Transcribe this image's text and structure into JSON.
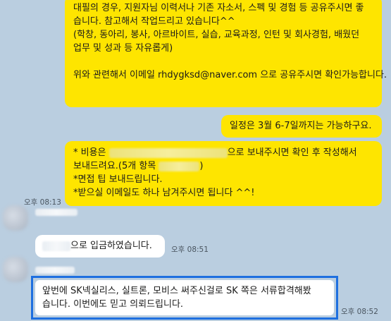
{
  "messages": {
    "m1": {
      "lines": [
        "대필의 경우, 지원자님 이력서나 기존 자소서, 스펙 및 경험 등 공유주시면 좋",
        "습니다. 참고해서 작업드리고 있습니다^^",
        "(학창, 동아리, 봉사, 아르바이트, 실습, 교육과정, 인턴 및 회사경험, 배웠던",
        "업무 및 성과 등 자유롭게)",
        "",
        "위와 관련해서 이메일 rhdygksd@naver.com 으로 공유주시면 확인가능합니다."
      ]
    },
    "m2": {
      "text": "일정은 3월 6-7일까지는 가능하구요."
    },
    "m3": {
      "line1_prefix": "* 비용은 ",
      "line1_suffix": "으로 보내주시면 확인 후 작성해서",
      "line2_prefix": "보내드려요.(5개 항목 ",
      "line2_suffix": ")",
      "line3": "*면접 팁 보내드립니다.",
      "line4": "*받으실 이메일도 하나 남겨주시면 됩니다 ^^!",
      "time": "오후 08:13"
    },
    "m4": {
      "text": "으로 입금하였습니다.",
      "time": "오후 08:51"
    },
    "m5": {
      "lines": [
        "앞번에 SK넥실리스, 실트론, 모비스 써주신걸로 SK 쪽은 서류합격해봤",
        "습니다. 이번에도 믿고 의뢰드립니다."
      ],
      "time": "오후 08:52"
    }
  },
  "colors": {
    "background": "#bacee0",
    "my_bubble": "#fee500",
    "other_bubble": "#ffffff",
    "highlight_border": "#1e6fe0"
  }
}
